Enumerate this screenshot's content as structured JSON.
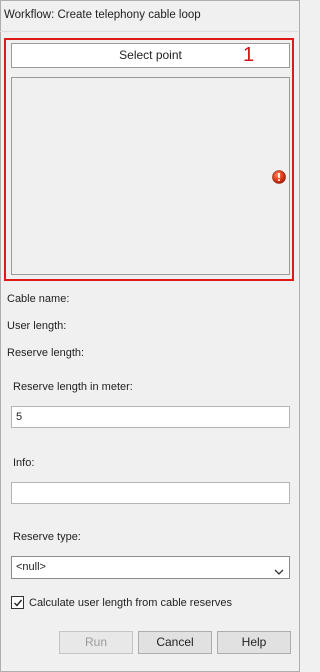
{
  "window": {
    "title": "Workflow: Create telephony cable loop"
  },
  "point_selector": {
    "select_point_label": "Select point",
    "callout_number": "1",
    "status_icon": "error-icon",
    "highlight_color": "#e01818"
  },
  "info_labels": {
    "cable_name": "Cable name:",
    "user_length": "User length:",
    "reserve_length": "Reserve length:"
  },
  "form": {
    "reserve_length_meter_label": "Reserve length in meter:",
    "reserve_length_meter_value": "5",
    "info_label": "Info:",
    "info_value": "",
    "reserve_type_label": "Reserve type:",
    "reserve_type_value": "<null>",
    "calculate_checkbox_label": "Calculate user length from cable reserves",
    "calculate_checked": true
  },
  "buttons": {
    "run": "Run",
    "cancel": "Cancel",
    "help": "Help"
  }
}
